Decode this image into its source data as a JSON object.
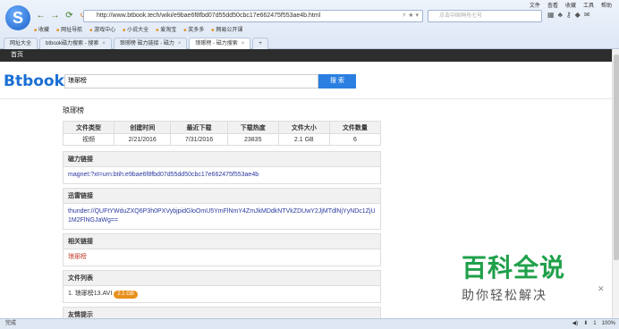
{
  "browser": {
    "logo_letter": "S",
    "top_menu": [
      "文件",
      "查看",
      "收藏",
      "工具",
      "帮助"
    ],
    "url": "http://www.btbook.tech/wiki/e9bae6f8fbd07d55dd50cbc17e662475f553ae4b.html",
    "search_placeholder": "点击中国神舟七号",
    "bookmarks": [
      "收藏",
      "网址导航",
      "游戏中心",
      "小说大全",
      "爱淘宝",
      "奖多多",
      "网易公开课"
    ],
    "tabs": [
      {
        "label": "网址大全",
        "active": false
      },
      {
        "label": "btbook磁力搜索 - 搜索",
        "active": false
      },
      {
        "label": "琅琊榜 磁力链接 - 磁力",
        "active": false
      },
      {
        "label": "琅琊榜 - 磁力搜索",
        "active": true
      }
    ]
  },
  "site": {
    "nav_home": "首页",
    "brand": "Btbook",
    "query": "琅琊榜",
    "search_button": "搜 索"
  },
  "main": {
    "title": "琅琊榜",
    "table": {
      "headers": [
        "文件类型",
        "创建时间",
        "最近下载",
        "下载热度",
        "文件大小",
        "文件数量"
      ],
      "row": [
        "视频",
        "2/21/2016",
        "7/31/2016",
        "23835",
        "2.1 GB",
        "6"
      ]
    },
    "magnet": {
      "heading": "磁力链接",
      "value": "magnet:?xt=urn:btih:e9bae6f8fbd07d55dd50cbc17e662475f553ae4b"
    },
    "thunder": {
      "heading": "迅雷链接",
      "value": "thunder://QUFtYWduZXQ6P3h0PXVybjpidGloOmU5YmFlNmY4ZmJkMDdkNTVkZDUwY2JjMTdlNjYyNDc1ZjU1M2FlNGJaWg=="
    },
    "related": {
      "heading": "相关链接",
      "value": "琅琊榜"
    },
    "files": {
      "heading": "文件列表",
      "item": "1. 琅琊榜13.AVI",
      "size": "2.1 GB"
    },
    "friends": {
      "heading": "友情提示"
    }
  },
  "watermark": {
    "title": "百科全说",
    "subtitle": "助你轻松解决"
  },
  "status": {
    "left": "完成",
    "zoom": "100%",
    "count": "1"
  }
}
